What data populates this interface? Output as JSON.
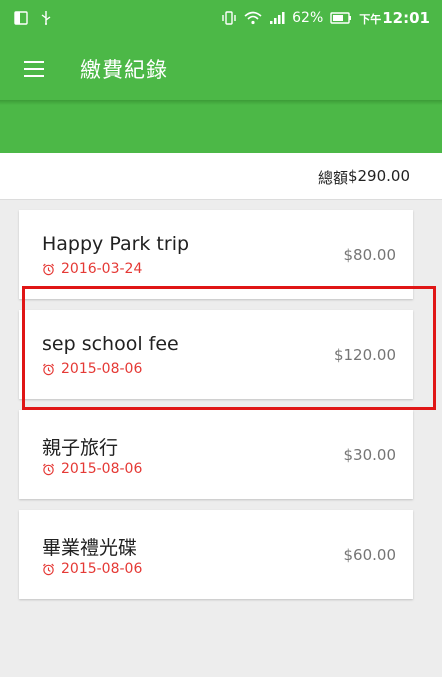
{
  "status_bar": {
    "battery_percent": "62%",
    "time_prefix": "下午",
    "time": "12:01"
  },
  "app_bar": {
    "title": "繳費紀錄"
  },
  "summary": {
    "total_label": "總額",
    "total_value": "$290.00"
  },
  "records": [
    {
      "title": "Happy Park trip",
      "date": "2016-03-24",
      "amount": "$80.00"
    },
    {
      "title": "sep school fee",
      "date": "2015-08-06",
      "amount": "$120.00"
    },
    {
      "title": "親子旅行",
      "date": "2015-08-06",
      "amount": "$30.00"
    },
    {
      "title": "畢業禮光碟",
      "date": "2015-08-06",
      "amount": "$60.00"
    }
  ],
  "colors": {
    "primary": "#4cb847",
    "date_red": "#e53935",
    "highlight": "#e01616"
  }
}
